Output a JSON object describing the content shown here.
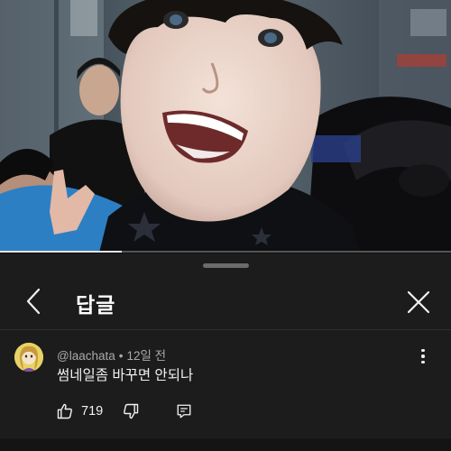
{
  "video": {
    "progress_fraction": 0.27
  },
  "sheet": {
    "title": "답글"
  },
  "comment": {
    "author": "@laachata",
    "separator": "•",
    "time": "12일 전",
    "text": "썸네일좀 바꾸면 안되나",
    "like_count": "719"
  },
  "icons": {
    "back": "chevron-left-icon",
    "close": "close-icon",
    "more": "more-vertical-icon",
    "like": "thumbs-up-icon",
    "dislike": "thumbs-down-icon",
    "reply": "reply-icon"
  },
  "colors": {
    "sheet_background": "#1c1c1c",
    "secondary_text": "#aaaaaa",
    "primary_text": "#f1f1f1"
  }
}
